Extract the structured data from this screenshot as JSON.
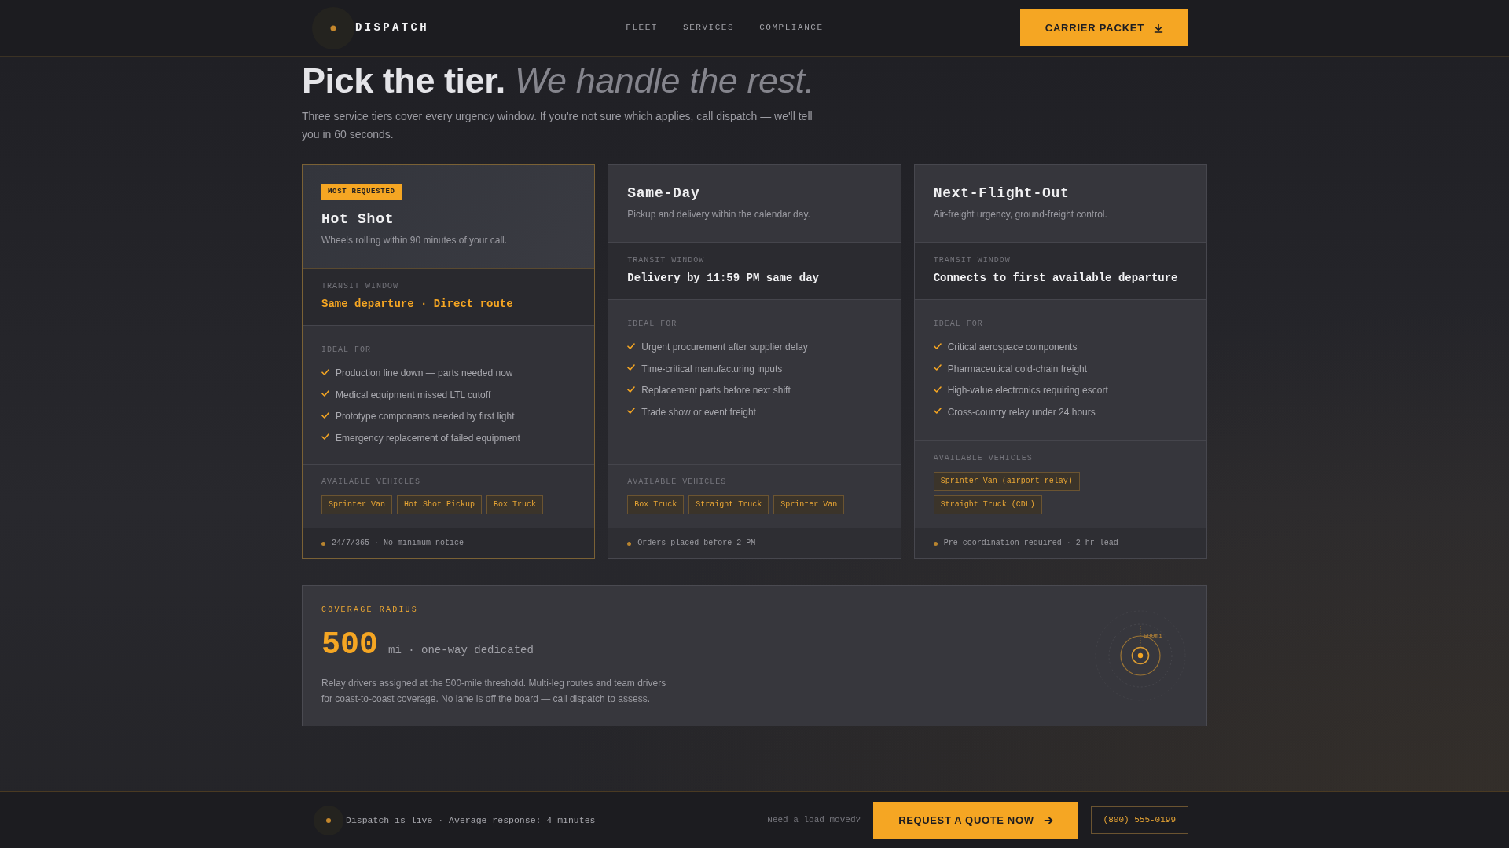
{
  "header": {
    "brand": "DISPATCH",
    "nav": [
      "FLEET",
      "SERVICES",
      "COMPLIANCE"
    ],
    "cta": "CARRIER PACKET"
  },
  "hero": {
    "title": "Pick the tier. *We handle the rest.*",
    "intro": "Three service tiers cover every urgency window. If you're not sure which applies, call dispatch — we'll tell you in 60 seconds."
  },
  "tiers": [
    {
      "featured": true,
      "badge": "MOST REQUESTED",
      "name": "Hot Shot",
      "description": "Wheels rolling within 90 minutes of your call.",
      "transit_label": "TRANSIT WINDOW",
      "transit": "Same departure · Direct route",
      "ideal_label": "IDEAL FOR",
      "ideal_for": [
        "Production line down — parts needed now",
        "Medical equipment missed LTL cutoff",
        "Prototype components needed by first light",
        "Emergency replacement of failed equipment"
      ],
      "vehicles_label": "AVAILABLE VEHICLES",
      "vehicles": [
        "Sprinter Van",
        "Hot Shot Pickup",
        "Box Truck"
      ],
      "note": "24/7/365 · No minimum notice"
    },
    {
      "featured": false,
      "name": "Same-Day",
      "description": "Pickup and delivery within the calendar day.",
      "transit_label": "TRANSIT WINDOW",
      "transit": "Delivery by 11:59 PM same day",
      "ideal_label": "IDEAL FOR",
      "ideal_for": [
        "Urgent procurement after supplier delay",
        "Time-critical manufacturing inputs",
        "Replacement parts before next shift",
        "Trade show or event freight"
      ],
      "vehicles_label": "AVAILABLE VEHICLES",
      "vehicles": [
        "Box Truck",
        "Straight Truck",
        "Sprinter Van"
      ],
      "note": "Orders placed before 2 PM"
    },
    {
      "featured": false,
      "name": "Next-Flight-Out",
      "description": "Air-freight urgency, ground-freight control.",
      "transit_label": "TRANSIT WINDOW",
      "transit": "Connects to first available departure",
      "ideal_label": "IDEAL FOR",
      "ideal_for": [
        "Critical aerospace components",
        "Pharmaceutical cold-chain freight",
        "High-value electronics requiring escort",
        "Cross-country relay under 24 hours"
      ],
      "vehicles_label": "AVAILABLE VEHICLES",
      "vehicles": [
        "Sprinter Van (airport relay)",
        "Straight Truck (CDL)"
      ],
      "note": "Pre-coordination required · 2 hr lead"
    }
  ],
  "coverage": {
    "label": "COVERAGE RADIUS",
    "value": "500",
    "unit": "mi · one-way dedicated",
    "description": "Relay drivers assigned at the 500-mile threshold. Multi-leg routes and team drivers for coast-to-coast coverage. No lane is off the board — call dispatch to assess.",
    "radius_label": "500mi"
  },
  "footer_bar": {
    "status": "Dispatch is live · Average response: 4 minutes",
    "prompt": "Need a load moved?",
    "cta": "REQUEST A QUOTE NOW",
    "phone": "(800) 555-0199"
  }
}
